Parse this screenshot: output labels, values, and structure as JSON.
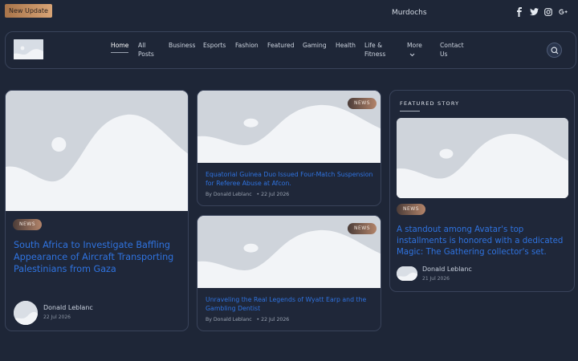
{
  "topbar": {
    "update_badge": "New Update",
    "ticker": "Murdochs",
    "socials": [
      "facebook-icon",
      "twitter-icon",
      "instagram-icon",
      "google-plus-icon"
    ]
  },
  "nav": {
    "items": [
      {
        "label": "Home",
        "active": true
      },
      {
        "label": "All\nPosts"
      },
      {
        "label": "Business"
      },
      {
        "label": "Esports"
      },
      {
        "label": "Fashion"
      },
      {
        "label": "Featured"
      },
      {
        "label": "Gaming"
      },
      {
        "label": "Health"
      },
      {
        "label": "Life &\nFitness"
      },
      {
        "label": "More"
      },
      {
        "label": "Contact\nUs"
      }
    ]
  },
  "cards": {
    "main": {
      "tag": "NEWS",
      "title": "South Africa to Investigate Baffling Appearance of Aircraft Transporting Palestinians from Gaza",
      "author": "Donald Leblanc",
      "date": "22 Jul 2026"
    },
    "mid1": {
      "tag": "NEWS",
      "title": "Equatorial Guinea Duo Issued Four-Match Suspension for Referee Abuse at Afcon.",
      "meta": "By Donald Leblanc   • 22 Jul 2026"
    },
    "mid2": {
      "tag": "NEWS",
      "title": "Unraveling the Real Legends of Wyatt Earp and the Gambling Dentist",
      "meta": "By Donald Leblanc   • 22 Jul 2026"
    },
    "featured": {
      "heading": "FEATURED STORY",
      "tag": "NEWS",
      "title": "A standout among Avatar's top installments is honored with a dedicated Magic: The Gathering collector's set.",
      "author": "Donald Leblanc",
      "date": "21 Jul 2026"
    }
  },
  "colors": {
    "accent": "#2f73e0",
    "background": "#1e2637",
    "border": "#39435a"
  }
}
